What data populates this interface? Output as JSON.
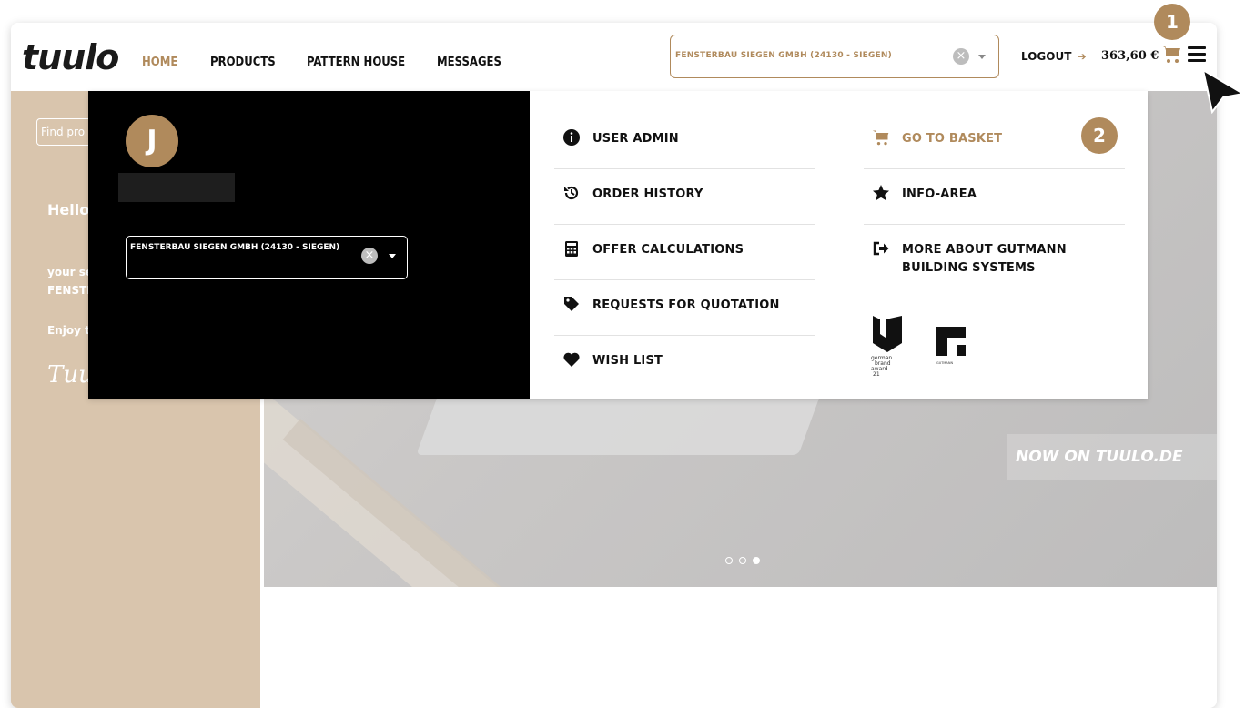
{
  "header": {
    "logo": "tuulo",
    "nav": [
      {
        "label": "HOME"
      },
      {
        "label": "PRODUCTS"
      },
      {
        "label": "PATTERN HOUSE"
      },
      {
        "label": "MESSAGES"
      }
    ],
    "company_select": "FENSTERBAU SIEGEN GMBH (24130 - SIEGEN)",
    "logout": "LOGOUT",
    "cart_total": "363,60 €"
  },
  "badges": {
    "first": "1",
    "second": "2"
  },
  "background": {
    "search_placeholder": "Find pro",
    "greeting": "Hello,",
    "line1": "your se",
    "line2": "FENSTI",
    "line3": "Enjoy t",
    "signature": "Tuul",
    "hero_tagline": "NOW ON TUULO.DE"
  },
  "menu": {
    "user": {
      "initial": "J",
      "company_select": "FENSTERBAU SIEGEN GMBH (24130 - SIEGEN)"
    },
    "col1": [
      {
        "label": "USER ADMIN",
        "icon": "info-icon"
      },
      {
        "label": "ORDER HISTORY",
        "icon": "history-icon"
      },
      {
        "label": "OFFER CALCULATIONS",
        "icon": "calculator-icon"
      },
      {
        "label": "REQUESTS FOR QUOTATION",
        "icon": "tag-icon"
      },
      {
        "label": "WISH LIST",
        "icon": "heart-icon"
      }
    ],
    "col2": [
      {
        "label": "GO TO BASKET",
        "icon": "cart-icon"
      },
      {
        "label": "INFO-AREA",
        "icon": "star-icon"
      },
      {
        "label": "MORE ABOUT GUTMANN BUILDING SYSTEMS",
        "icon": "sign-out-icon"
      }
    ],
    "brand_logos": {
      "award": "german brand award 21",
      "gutmann": "GUTMANN"
    }
  },
  "colors": {
    "accent": "#b08a5c",
    "sidebar": "#d9c5ad"
  }
}
